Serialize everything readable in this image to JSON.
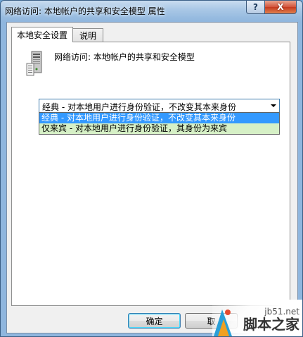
{
  "window": {
    "title": "网络访问: 本地帐户的共享和安全模型 属性",
    "help_glyph": "?",
    "close_glyph": "X"
  },
  "tabs": [
    {
      "label": "本地安全设置",
      "active": true
    },
    {
      "label": "说明",
      "active": false
    }
  ],
  "policy": {
    "icon": "server-icon",
    "heading": "网络访问: 本地帐户的共享和安全模型"
  },
  "combo": {
    "selected": "经典 - 对本地用户进行身份验证，不改变其本来身份",
    "options": [
      "经典 - 对本地用户进行身份验证，不改变其本来身份",
      "仅来宾 - 对本地用户进行身份验证，其身份为来宾"
    ]
  },
  "buttons": {
    "ok": "确定",
    "cancel": "取"
  },
  "watermark": {
    "site": "jb51.net",
    "name": "脚本之家"
  },
  "colors": {
    "selection": "#3399ff",
    "hover_option": "#d6f0c6",
    "close_button": "#c43a1f"
  }
}
